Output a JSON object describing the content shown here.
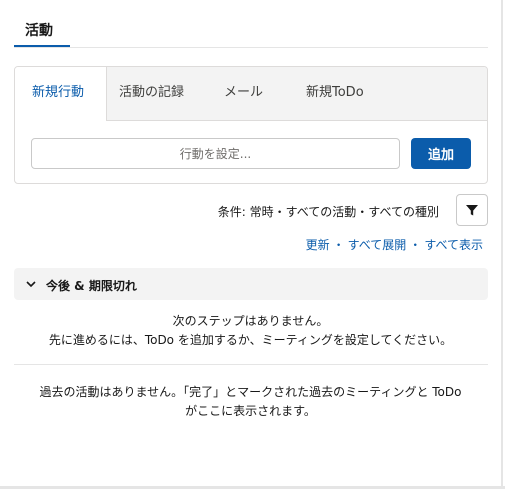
{
  "header": {
    "tab_label": "活動"
  },
  "composer": {
    "tabs": [
      "新規行動",
      "活動の記録",
      "メール",
      "新規ToDo"
    ],
    "input_placeholder": "行動を設定...",
    "add_label": "追加"
  },
  "filter": {
    "text": "条件: 常時・すべての活動・すべての種別",
    "icon": "filter-icon"
  },
  "links": {
    "refresh": "更新",
    "sep": "・",
    "expand_all": "すべて展開",
    "show_all": "すべて表示"
  },
  "upcoming": {
    "title": "今後 & 期限切れ",
    "empty_line1": "次のステップはありません。",
    "empty_line2": "先に進めるには、ToDo を追加するか、ミーティングを設定してください。"
  },
  "past": {
    "empty_line1": "過去の活動はありません。「完了」とマークされた過去のミーティングと ToDo",
    "empty_line2": "がここに表示されます。"
  },
  "colors": {
    "accent": "#0b5cab",
    "tab_bg": "#f3f3f3",
    "border": "#dddbda"
  }
}
